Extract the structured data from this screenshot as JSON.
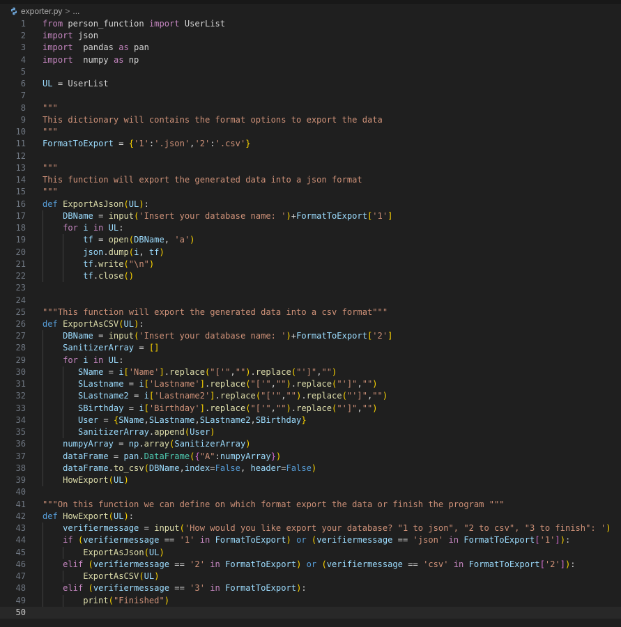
{
  "breadcrumb": {
    "file": "exporter.py",
    "separator": ">",
    "ellipsis": "..."
  },
  "current_line": 50,
  "lines": [
    [
      [
        "k",
        "from"
      ],
      [
        "p",
        " person_function "
      ],
      [
        "k",
        "import"
      ],
      [
        "p",
        " UserList"
      ]
    ],
    [
      [
        "k",
        "import"
      ],
      [
        "p",
        " json"
      ]
    ],
    [
      [
        "k",
        "import"
      ],
      [
        "p",
        "  pandas "
      ],
      [
        "k",
        "as"
      ],
      [
        "p",
        " pan"
      ]
    ],
    [
      [
        "k",
        "import"
      ],
      [
        "p",
        "  numpy "
      ],
      [
        "k",
        "as"
      ],
      [
        "p",
        " np"
      ]
    ],
    [],
    [
      [
        "v",
        "UL"
      ],
      [
        "p",
        " = UserList"
      ]
    ],
    [],
    [
      [
        "doc",
        "\"\"\""
      ]
    ],
    [
      [
        "doc",
        "This dictionary will contains the format options to export the data"
      ]
    ],
    [
      [
        "doc",
        "\"\"\""
      ]
    ],
    [
      [
        "v",
        "FormatToExport"
      ],
      [
        "p",
        " = "
      ],
      [
        "br1",
        "{"
      ],
      [
        "s",
        "'1'"
      ],
      [
        "p",
        ":"
      ],
      [
        "s",
        "'.json'"
      ],
      [
        "p",
        ","
      ],
      [
        "s",
        "'2'"
      ],
      [
        "p",
        ":"
      ],
      [
        "s",
        "'.csv'"
      ],
      [
        "br1",
        "}"
      ]
    ],
    [],
    [
      [
        "doc",
        "\"\"\""
      ]
    ],
    [
      [
        "doc",
        "This function will export the generated data into a json format"
      ]
    ],
    [
      [
        "doc",
        "\"\"\""
      ]
    ],
    [
      [
        "d",
        "def"
      ],
      [
        "p",
        " "
      ],
      [
        "fn",
        "ExportAsJson"
      ],
      [
        "br1",
        "("
      ],
      [
        "prm",
        "UL"
      ],
      [
        "br1",
        ")"
      ],
      [
        "p",
        ":"
      ]
    ],
    [
      [
        "p",
        "    "
      ],
      [
        "v",
        "DBName"
      ],
      [
        "p",
        " = "
      ],
      [
        "fn",
        "input"
      ],
      [
        "br1",
        "("
      ],
      [
        "s",
        "'Insert your database name: '"
      ],
      [
        "br1",
        ")"
      ],
      [
        "p",
        "+"
      ],
      [
        "v",
        "FormatToExport"
      ],
      [
        "br1",
        "["
      ],
      [
        "s",
        "'1'"
      ],
      [
        "br1",
        "]"
      ]
    ],
    [
      [
        "p",
        "    "
      ],
      [
        "k",
        "for"
      ],
      [
        "p",
        " "
      ],
      [
        "v",
        "i"
      ],
      [
        "p",
        " "
      ],
      [
        "k",
        "in"
      ],
      [
        "p",
        " "
      ],
      [
        "v",
        "UL"
      ],
      [
        "p",
        ":"
      ]
    ],
    [
      [
        "p",
        "        "
      ],
      [
        "v",
        "tf"
      ],
      [
        "p",
        " = "
      ],
      [
        "fn",
        "open"
      ],
      [
        "br1",
        "("
      ],
      [
        "v",
        "DBName"
      ],
      [
        "p",
        ", "
      ],
      [
        "s",
        "'a'"
      ],
      [
        "br1",
        ")"
      ]
    ],
    [
      [
        "p",
        "        "
      ],
      [
        "v",
        "json"
      ],
      [
        "p",
        "."
      ],
      [
        "fn",
        "dump"
      ],
      [
        "br1",
        "("
      ],
      [
        "v",
        "i"
      ],
      [
        "p",
        ", "
      ],
      [
        "v",
        "tf"
      ],
      [
        "br1",
        ")"
      ]
    ],
    [
      [
        "p",
        "        "
      ],
      [
        "v",
        "tf"
      ],
      [
        "p",
        "."
      ],
      [
        "fn",
        "write"
      ],
      [
        "br1",
        "("
      ],
      [
        "s",
        "\"\\n\""
      ],
      [
        "br1",
        ")"
      ]
    ],
    [
      [
        "p",
        "        "
      ],
      [
        "v",
        "tf"
      ],
      [
        "p",
        "."
      ],
      [
        "fn",
        "close"
      ],
      [
        "br1",
        "()"
      ]
    ],
    [],
    [],
    [
      [
        "doc",
        "\"\"\"This function will export the generated data into a csv format\"\"\""
      ]
    ],
    [
      [
        "d",
        "def"
      ],
      [
        "p",
        " "
      ],
      [
        "fn",
        "ExportAsCSV"
      ],
      [
        "br1",
        "("
      ],
      [
        "prm",
        "UL"
      ],
      [
        "br1",
        ")"
      ],
      [
        "p",
        ":"
      ]
    ],
    [
      [
        "p",
        "    "
      ],
      [
        "v",
        "DBName"
      ],
      [
        "p",
        " = "
      ],
      [
        "fn",
        "input"
      ],
      [
        "br1",
        "("
      ],
      [
        "s",
        "'Insert your database name: '"
      ],
      [
        "br1",
        ")"
      ],
      [
        "p",
        "+"
      ],
      [
        "v",
        "FormatToExport"
      ],
      [
        "br1",
        "["
      ],
      [
        "s",
        "'2'"
      ],
      [
        "br1",
        "]"
      ]
    ],
    [
      [
        "p",
        "    "
      ],
      [
        "v",
        "SanitizerArray"
      ],
      [
        "p",
        " = "
      ],
      [
        "br1",
        "[]"
      ]
    ],
    [
      [
        "p",
        "    "
      ],
      [
        "k",
        "for"
      ],
      [
        "p",
        " "
      ],
      [
        "v",
        "i"
      ],
      [
        "p",
        " "
      ],
      [
        "k",
        "in"
      ],
      [
        "p",
        " "
      ],
      [
        "v",
        "UL"
      ],
      [
        "p",
        ":"
      ]
    ],
    [
      [
        "p",
        "       "
      ],
      [
        "v",
        "SName"
      ],
      [
        "p",
        " = "
      ],
      [
        "v",
        "i"
      ],
      [
        "br1",
        "["
      ],
      [
        "s",
        "'Name'"
      ],
      [
        "br1",
        "]"
      ],
      [
        "p",
        "."
      ],
      [
        "fn",
        "replace"
      ],
      [
        "br1",
        "("
      ],
      [
        "s",
        "\"['\""
      ],
      [
        "p",
        ","
      ],
      [
        "s",
        "\"\""
      ],
      [
        "br1",
        ")"
      ],
      [
        "p",
        "."
      ],
      [
        "fn",
        "replace"
      ],
      [
        "br1",
        "("
      ],
      [
        "s",
        "\"']\""
      ],
      [
        "p",
        ","
      ],
      [
        "s",
        "\"\""
      ],
      [
        "br1",
        ")"
      ]
    ],
    [
      [
        "p",
        "       "
      ],
      [
        "v",
        "SLastname"
      ],
      [
        "p",
        " = "
      ],
      [
        "v",
        "i"
      ],
      [
        "br1",
        "["
      ],
      [
        "s",
        "'Lastname'"
      ],
      [
        "br1",
        "]"
      ],
      [
        "p",
        "."
      ],
      [
        "fn",
        "replace"
      ],
      [
        "br1",
        "("
      ],
      [
        "s",
        "\"['\""
      ],
      [
        "p",
        ","
      ],
      [
        "s",
        "\"\""
      ],
      [
        "br1",
        ")"
      ],
      [
        "p",
        "."
      ],
      [
        "fn",
        "replace"
      ],
      [
        "br1",
        "("
      ],
      [
        "s",
        "\"']\""
      ],
      [
        "p",
        ","
      ],
      [
        "s",
        "\"\""
      ],
      [
        "br1",
        ")"
      ]
    ],
    [
      [
        "p",
        "       "
      ],
      [
        "v",
        "SLastname2"
      ],
      [
        "p",
        " = "
      ],
      [
        "v",
        "i"
      ],
      [
        "br1",
        "["
      ],
      [
        "s",
        "'Lastname2'"
      ],
      [
        "br1",
        "]"
      ],
      [
        "p",
        "."
      ],
      [
        "fn",
        "replace"
      ],
      [
        "br1",
        "("
      ],
      [
        "s",
        "\"['\""
      ],
      [
        "p",
        ","
      ],
      [
        "s",
        "\"\""
      ],
      [
        "br1",
        ")"
      ],
      [
        "p",
        "."
      ],
      [
        "fn",
        "replace"
      ],
      [
        "br1",
        "("
      ],
      [
        "s",
        "\"']\""
      ],
      [
        "p",
        ","
      ],
      [
        "s",
        "\"\""
      ],
      [
        "br1",
        ")"
      ]
    ],
    [
      [
        "p",
        "       "
      ],
      [
        "v",
        "SBirthday"
      ],
      [
        "p",
        " = "
      ],
      [
        "v",
        "i"
      ],
      [
        "br1",
        "["
      ],
      [
        "s",
        "'Birthday'"
      ],
      [
        "br1",
        "]"
      ],
      [
        "p",
        "."
      ],
      [
        "fn",
        "replace"
      ],
      [
        "br1",
        "("
      ],
      [
        "s",
        "\"['\""
      ],
      [
        "p",
        ","
      ],
      [
        "s",
        "\"\""
      ],
      [
        "br1",
        ")"
      ],
      [
        "p",
        "."
      ],
      [
        "fn",
        "replace"
      ],
      [
        "br1",
        "("
      ],
      [
        "s",
        "\"']\""
      ],
      [
        "p",
        ","
      ],
      [
        "s",
        "\"\""
      ],
      [
        "br1",
        ")"
      ]
    ],
    [
      [
        "p",
        "       "
      ],
      [
        "v",
        "User"
      ],
      [
        "p",
        " = "
      ],
      [
        "br1",
        "{"
      ],
      [
        "v",
        "SName"
      ],
      [
        "p",
        ","
      ],
      [
        "v",
        "SLastname"
      ],
      [
        "p",
        ","
      ],
      [
        "v",
        "SLastname2"
      ],
      [
        "p",
        ","
      ],
      [
        "v",
        "SBirthday"
      ],
      [
        "br1",
        "}"
      ]
    ],
    [
      [
        "p",
        "       "
      ],
      [
        "v",
        "SanitizerArray"
      ],
      [
        "p",
        "."
      ],
      [
        "fn",
        "append"
      ],
      [
        "br1",
        "("
      ],
      [
        "v",
        "User"
      ],
      [
        "br1",
        ")"
      ]
    ],
    [
      [
        "p",
        "    "
      ],
      [
        "v",
        "numpyArray"
      ],
      [
        "p",
        " = "
      ],
      [
        "v",
        "np"
      ],
      [
        "p",
        "."
      ],
      [
        "fn",
        "array"
      ],
      [
        "br1",
        "("
      ],
      [
        "v",
        "SanitizerArray"
      ],
      [
        "br1",
        ")"
      ]
    ],
    [
      [
        "p",
        "    "
      ],
      [
        "v",
        "dataFrame"
      ],
      [
        "p",
        " = "
      ],
      [
        "v",
        "pan"
      ],
      [
        "p",
        "."
      ],
      [
        "cs",
        "DataFrame"
      ],
      [
        "br1",
        "("
      ],
      [
        "br2",
        "{"
      ],
      [
        "s",
        "\"A\""
      ],
      [
        "p",
        ":"
      ],
      [
        "v",
        "numpyArray"
      ],
      [
        "br2",
        "}"
      ],
      [
        "br1",
        ")"
      ]
    ],
    [
      [
        "p",
        "    "
      ],
      [
        "v",
        "dataFrame"
      ],
      [
        "p",
        "."
      ],
      [
        "fn",
        "to_csv"
      ],
      [
        "br1",
        "("
      ],
      [
        "v",
        "DBName"
      ],
      [
        "p",
        ","
      ],
      [
        "prm",
        "index"
      ],
      [
        "p",
        "="
      ],
      [
        "d",
        "False"
      ],
      [
        "p",
        ", "
      ],
      [
        "prm",
        "header"
      ],
      [
        "p",
        "="
      ],
      [
        "d",
        "False"
      ],
      [
        "br1",
        ")"
      ]
    ],
    [
      [
        "p",
        "    "
      ],
      [
        "fn",
        "HowExport"
      ],
      [
        "br1",
        "("
      ],
      [
        "v",
        "UL"
      ],
      [
        "br1",
        ")"
      ]
    ],
    [],
    [
      [
        "doc",
        "\"\"\"On this function we can define on which format export the data or finish the program \"\"\""
      ]
    ],
    [
      [
        "d",
        "def"
      ],
      [
        "p",
        " "
      ],
      [
        "fn",
        "HowExport"
      ],
      [
        "br1",
        "("
      ],
      [
        "prm",
        "UL"
      ],
      [
        "br1",
        ")"
      ],
      [
        "p",
        ":"
      ]
    ],
    [
      [
        "p",
        "    "
      ],
      [
        "v",
        "verifiermessage"
      ],
      [
        "p",
        " = "
      ],
      [
        "fn",
        "input"
      ],
      [
        "br1",
        "("
      ],
      [
        "s",
        "'How would you like export your database? \"1 to json\", \"2 to csv\", \"3 to finish\": '"
      ],
      [
        "br1",
        ")"
      ]
    ],
    [
      [
        "p",
        "    "
      ],
      [
        "k",
        "if"
      ],
      [
        "p",
        " "
      ],
      [
        "br1",
        "("
      ],
      [
        "v",
        "verifiermessage"
      ],
      [
        "p",
        " == "
      ],
      [
        "s",
        "'1'"
      ],
      [
        "p",
        " "
      ],
      [
        "k",
        "in"
      ],
      [
        "p",
        " "
      ],
      [
        "v",
        "FormatToExport"
      ],
      [
        "br1",
        ")"
      ],
      [
        "p",
        " "
      ],
      [
        "d",
        "or"
      ],
      [
        "p",
        " "
      ],
      [
        "br1",
        "("
      ],
      [
        "v",
        "verifiermessage"
      ],
      [
        "p",
        " == "
      ],
      [
        "s",
        "'json'"
      ],
      [
        "p",
        " "
      ],
      [
        "k",
        "in"
      ],
      [
        "p",
        " "
      ],
      [
        "v",
        "FormatToExport"
      ],
      [
        "br2",
        "["
      ],
      [
        "s",
        "'1'"
      ],
      [
        "br2",
        "]"
      ],
      [
        "br1",
        ")"
      ],
      [
        "p",
        ":"
      ]
    ],
    [
      [
        "p",
        "        "
      ],
      [
        "fn",
        "ExportAsJson"
      ],
      [
        "br1",
        "("
      ],
      [
        "v",
        "UL"
      ],
      [
        "br1",
        ")"
      ]
    ],
    [
      [
        "p",
        "    "
      ],
      [
        "k",
        "elif"
      ],
      [
        "p",
        " "
      ],
      [
        "br1",
        "("
      ],
      [
        "v",
        "verifiermessage"
      ],
      [
        "p",
        " == "
      ],
      [
        "s",
        "'2'"
      ],
      [
        "p",
        " "
      ],
      [
        "k",
        "in"
      ],
      [
        "p",
        " "
      ],
      [
        "v",
        "FormatToExport"
      ],
      [
        "br1",
        ")"
      ],
      [
        "p",
        " "
      ],
      [
        "d",
        "or"
      ],
      [
        "p",
        " "
      ],
      [
        "br1",
        "("
      ],
      [
        "v",
        "verifiermessage"
      ],
      [
        "p",
        " == "
      ],
      [
        "s",
        "'csv'"
      ],
      [
        "p",
        " "
      ],
      [
        "k",
        "in"
      ],
      [
        "p",
        " "
      ],
      [
        "v",
        "FormatToExport"
      ],
      [
        "br2",
        "["
      ],
      [
        "s",
        "'2'"
      ],
      [
        "br2",
        "]"
      ],
      [
        "br1",
        ")"
      ],
      [
        "p",
        ":"
      ]
    ],
    [
      [
        "p",
        "        "
      ],
      [
        "fn",
        "ExportAsCSV"
      ],
      [
        "br1",
        "("
      ],
      [
        "v",
        "UL"
      ],
      [
        "br1",
        ")"
      ]
    ],
    [
      [
        "p",
        "    "
      ],
      [
        "k",
        "elif"
      ],
      [
        "p",
        " "
      ],
      [
        "br1",
        "("
      ],
      [
        "v",
        "verifiermessage"
      ],
      [
        "p",
        " == "
      ],
      [
        "s",
        "'3'"
      ],
      [
        "p",
        " "
      ],
      [
        "k",
        "in"
      ],
      [
        "p",
        " "
      ],
      [
        "v",
        "FormatToExport"
      ],
      [
        "br1",
        ")"
      ],
      [
        "p",
        ":"
      ]
    ],
    [
      [
        "p",
        "        "
      ],
      [
        "fn",
        "print"
      ],
      [
        "br1",
        "("
      ],
      [
        "s",
        "\"Finished\""
      ],
      [
        "br1",
        ")"
      ]
    ],
    []
  ]
}
